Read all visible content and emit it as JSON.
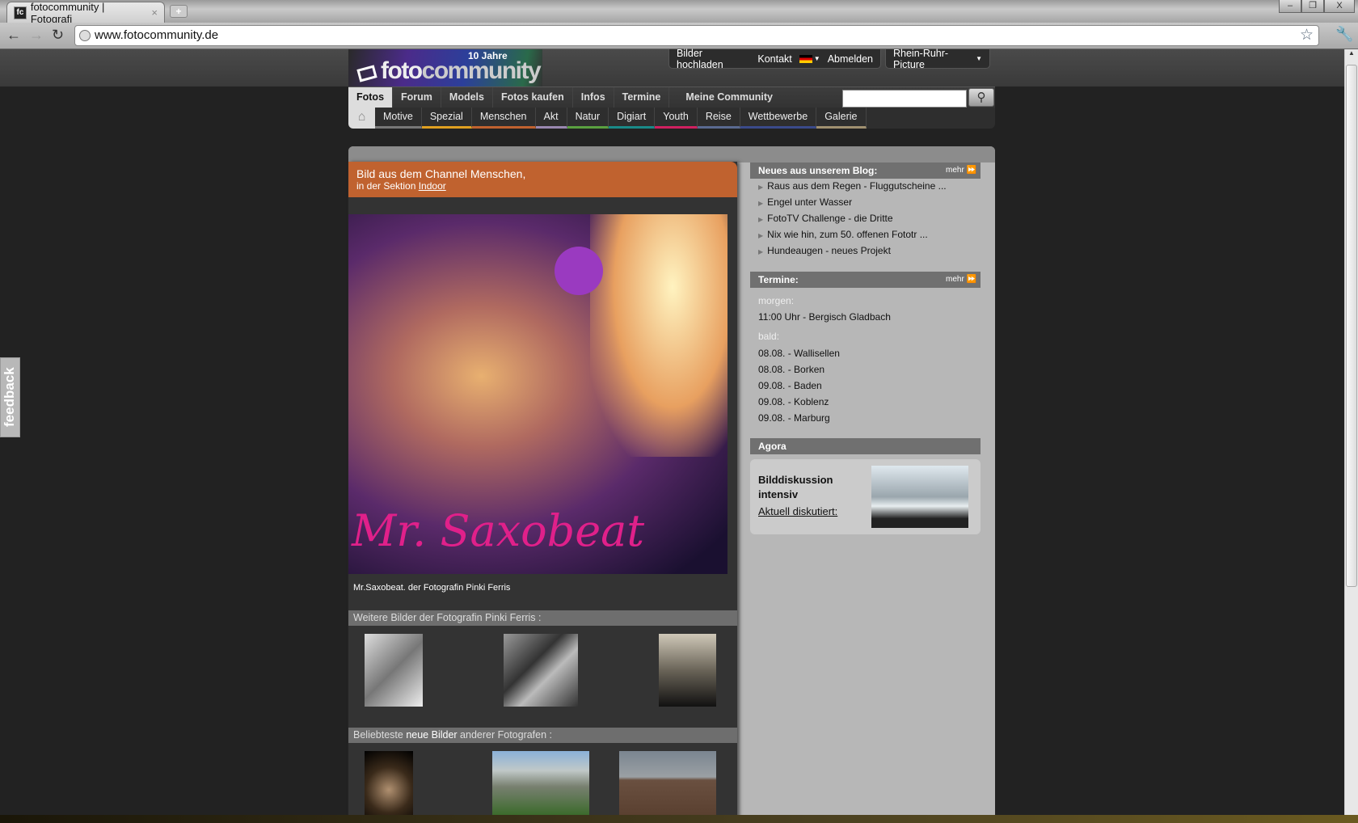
{
  "browser": {
    "tab_title": "fotocommunity | Fotografi",
    "url": "www.fotocommunity.de",
    "new_tab": "+",
    "close_tab": "×",
    "favicon": "fc"
  },
  "site": {
    "logo_years": "10 Jahre",
    "logo_name_a": "foto",
    "logo_name_b": "community",
    "top_links": [
      "Bilder hochladen",
      "Kontakt",
      "Abmelden"
    ],
    "user_menu": "Rhein-Ruhr-Picture",
    "main_nav": [
      "Fotos",
      "Forum",
      "Models",
      "Fotos kaufen",
      "Infos",
      "Termine"
    ],
    "community": "Meine Community",
    "search": {
      "value": "",
      "placeholder": ""
    },
    "sub_nav": [
      {
        "label": "Motive",
        "color": "#777777"
      },
      {
        "label": "Spezial",
        "color": "#e0a020"
      },
      {
        "label": "Menschen",
        "color": "#c0622f"
      },
      {
        "label": "Akt",
        "color": "#9a88b0"
      },
      {
        "label": "Natur",
        "color": "#5aa040"
      },
      {
        "label": "Digiart",
        "color": "#1a8a88"
      },
      {
        "label": "Youth",
        "color": "#d02060"
      },
      {
        "label": "Reise",
        "color": "#5a6a90"
      },
      {
        "label": "Wettbewerbe",
        "color": "#3a4a8a"
      },
      {
        "label": "Galerie",
        "color": "#a09070"
      }
    ],
    "accent": "#c0622f"
  },
  "feature": {
    "line1": "Bild aus dem Channel Menschen,",
    "line2_prefix": "in der Sektion ",
    "section_link": "Indoor",
    "watermark": "Mr. Saxobeat",
    "caption_prefix": "Mr.Saxobeat. der Fotografin ",
    "photographer": "Pinki Ferris",
    "more_by": "Weitere Bilder der Fotografin Pinki Ferris :",
    "popular_prefix": "Beliebteste ",
    "popular_link": "neue Bilder",
    "popular_suffix": " anderer Fotografen :"
  },
  "blog": {
    "title": "Neues aus unserem Blog:",
    "more": "mehr ⏩",
    "items": [
      "Raus aus dem Regen - Fluggutscheine ...",
      "Engel unter Wasser",
      "FotoTV Challenge - die Dritte",
      "Nix wie hin, zum 50. offenen Fototr ...",
      "Hundeaugen - neues Projekt"
    ]
  },
  "termine": {
    "title": "Termine:",
    "more": "mehr ⏩",
    "tomorrow_label": "morgen:",
    "tomorrow": {
      "time": "11:00 Uhr - ",
      "place": "Bergisch Gladbach"
    },
    "soon_label": "bald:",
    "soon": [
      {
        "date": "08.08. - ",
        "place": "Wallisellen"
      },
      {
        "date": "08.08. - ",
        "place": "Borken"
      },
      {
        "date": "09.08. - ",
        "place": "Baden"
      },
      {
        "date": "09.08. - ",
        "place": "Koblenz"
      },
      {
        "date": "09.08. - ",
        "place": "Marburg"
      }
    ]
  },
  "agora": {
    "title": "Agora",
    "text": "Bilddiskussion intensiv",
    "link": "Aktuell diskutiert:"
  },
  "feedback": "feedback"
}
